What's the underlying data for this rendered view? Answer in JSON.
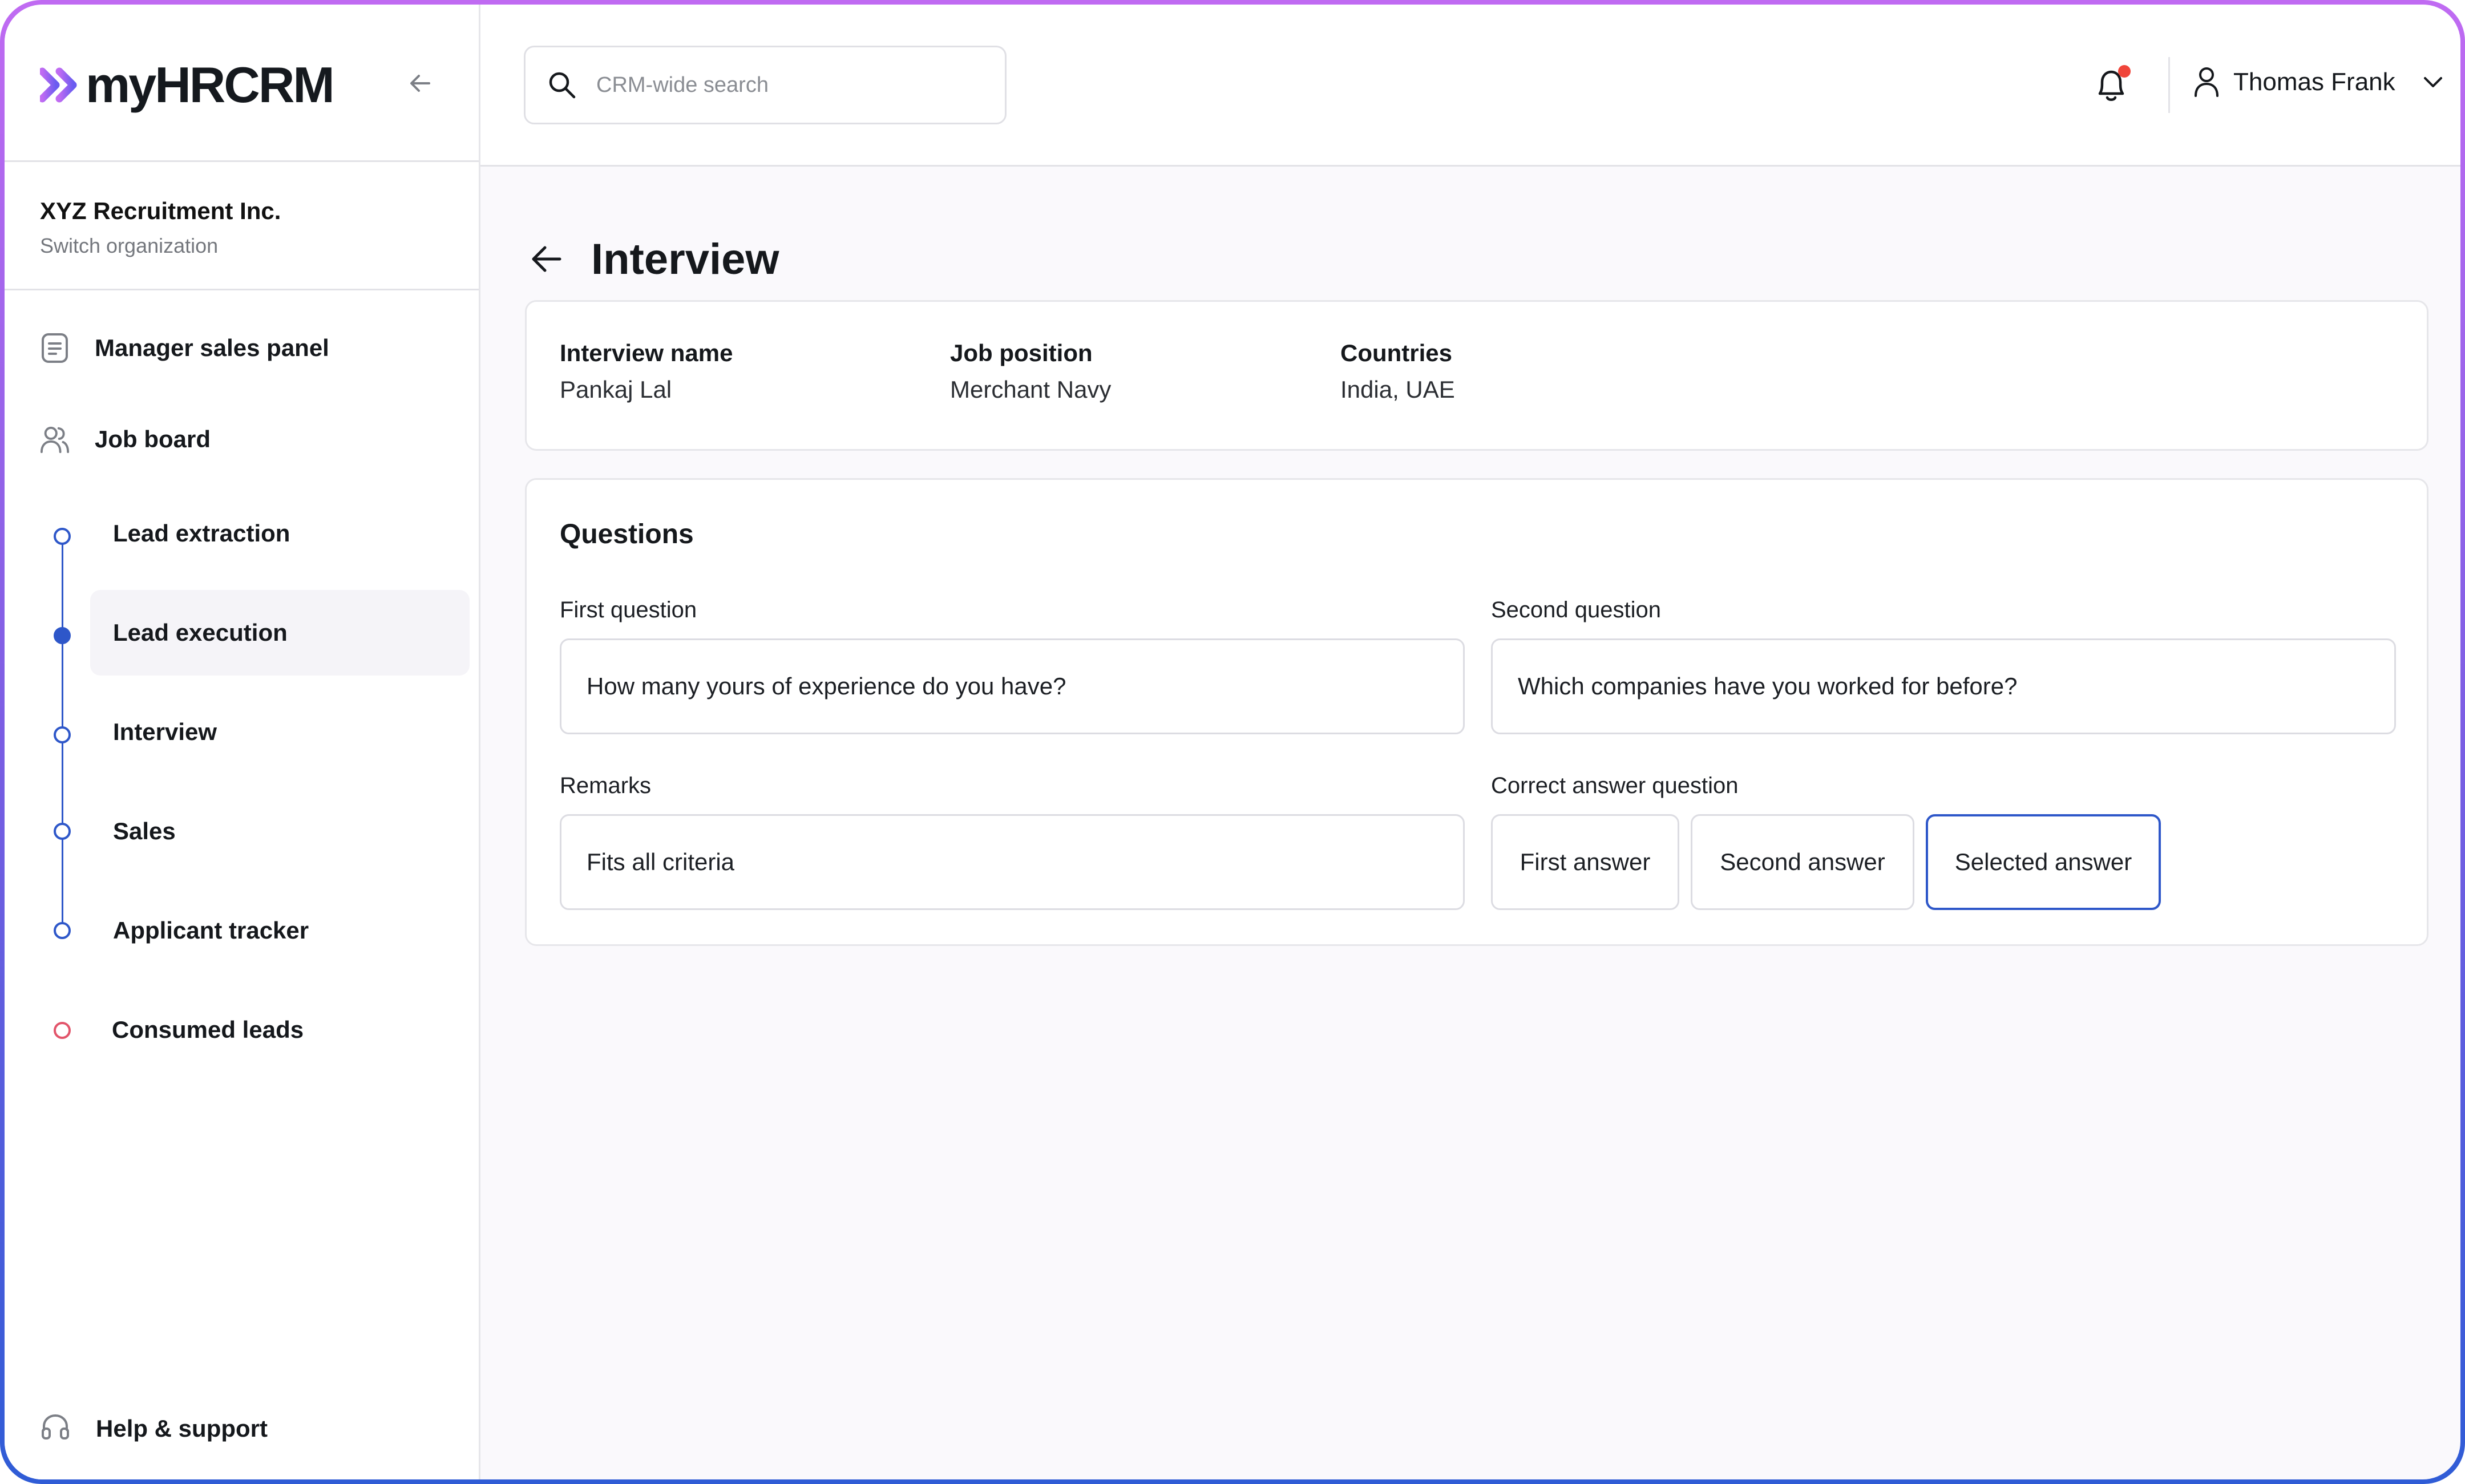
{
  "brand": {
    "name": "myHRCRM",
    "accent": "#8b5cf6"
  },
  "organization": {
    "name": "XYZ Recruitment Inc.",
    "switch_label": "Switch organization"
  },
  "sidebar": {
    "items": [
      {
        "label": "Manager sales panel",
        "icon": "document-icon"
      },
      {
        "label": "Job board",
        "icon": "users-icon"
      }
    ],
    "sub_items": [
      {
        "label": "Lead extraction"
      },
      {
        "label": "Lead execution",
        "active": true
      },
      {
        "label": "Interview"
      },
      {
        "label": "Sales"
      },
      {
        "label": "Applicant tracker"
      }
    ],
    "consumed": {
      "label": "Consumed leads"
    },
    "help": {
      "label": "Help & support",
      "icon": "headset-icon"
    }
  },
  "header": {
    "search_placeholder": "CRM-wide search",
    "notifications_unread": true,
    "user_name": "Thomas Frank"
  },
  "page": {
    "title": "Interview",
    "info": {
      "interview_name_label": "Interview name",
      "interview_name": "Pankaj Lal",
      "job_position_label": "Job position",
      "job_position": "Merchant Navy",
      "countries_label": "Countries",
      "countries": "India, UAE"
    },
    "questions": {
      "title": "Questions",
      "first_label": "First question",
      "first_value": "How many yours of experience do you have?",
      "second_label": "Second question",
      "second_value": "Which companies have you worked for before?",
      "remarks_label": "Remarks",
      "remarks_value": "Fits all criteria",
      "correct_label": "Correct answer question",
      "answers": [
        "First answer",
        "Second answer",
        "Selected answer"
      ],
      "selected_answer": "Selected answer"
    }
  },
  "colors": {
    "primary": "#2e57c9",
    "notification": "#f0453a",
    "consumed": "#e2546a"
  }
}
